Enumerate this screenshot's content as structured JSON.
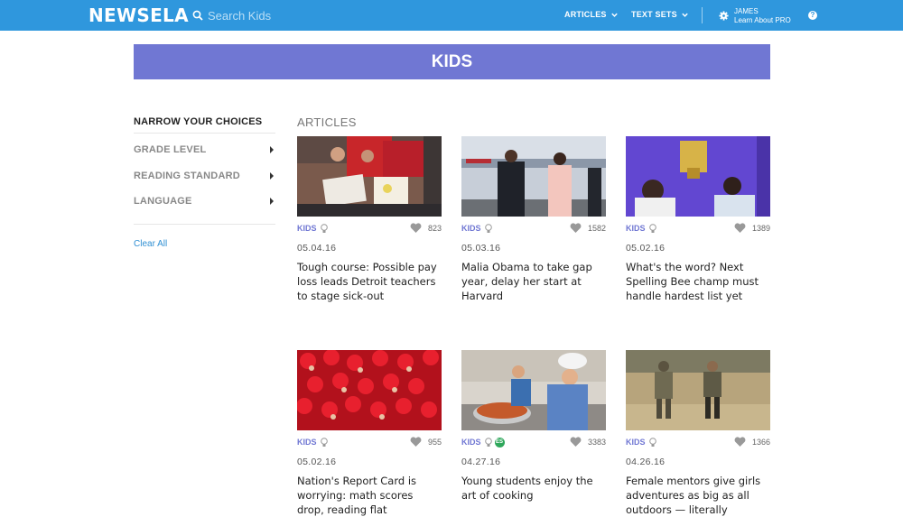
{
  "header": {
    "logo": "NEWSELA",
    "search_placeholder": "Search Kids",
    "nav": [
      {
        "label": "ARTICLES"
      },
      {
        "label": "TEXT SETS"
      }
    ],
    "user": {
      "name": "JAMES",
      "subtitle": "Learn About PRO"
    },
    "help_label": "?"
  },
  "banner": {
    "title": "KIDS"
  },
  "sidebar": {
    "title": "NARROW YOUR CHOICES",
    "filters": [
      {
        "label": "GRADE LEVEL"
      },
      {
        "label": "READING STANDARD"
      },
      {
        "label": "LANGUAGE"
      }
    ],
    "clear_all": "Clear All"
  },
  "articles": {
    "heading": "ARTICLES",
    "items": [
      {
        "tag": "KIDS",
        "likes": "823",
        "date": "05.04.16",
        "title": "Tough course: Possible pay loss leads Detroit teachers to stage sick-out"
      },
      {
        "tag": "KIDS",
        "likes": "1582",
        "date": "05.03.16",
        "title": "Malia Obama to take gap year, delay her start at Harvard"
      },
      {
        "tag": "KIDS",
        "likes": "1389",
        "date": "05.02.16",
        "title": "What's the word? Next Spelling Bee champ must handle hardest list yet"
      },
      {
        "tag": "KIDS",
        "likes": "955",
        "date": "05.02.16",
        "title": "Nation's Report Card is worrying: math scores drop, reading flat"
      },
      {
        "tag": "KIDS",
        "likes": "3383",
        "date": "04.27.16",
        "title": "Young students enjoy the art of cooking",
        "badge": "ES"
      },
      {
        "tag": "KIDS",
        "likes": "1366",
        "date": "04.26.16",
        "title": "Female mentors give girls adventures as big as all outdoors — literally"
      }
    ]
  },
  "colors": {
    "topbar": "#2f97dd",
    "banner": "#7077d3",
    "tag": "#7077d3",
    "link": "#2f8fd3"
  }
}
